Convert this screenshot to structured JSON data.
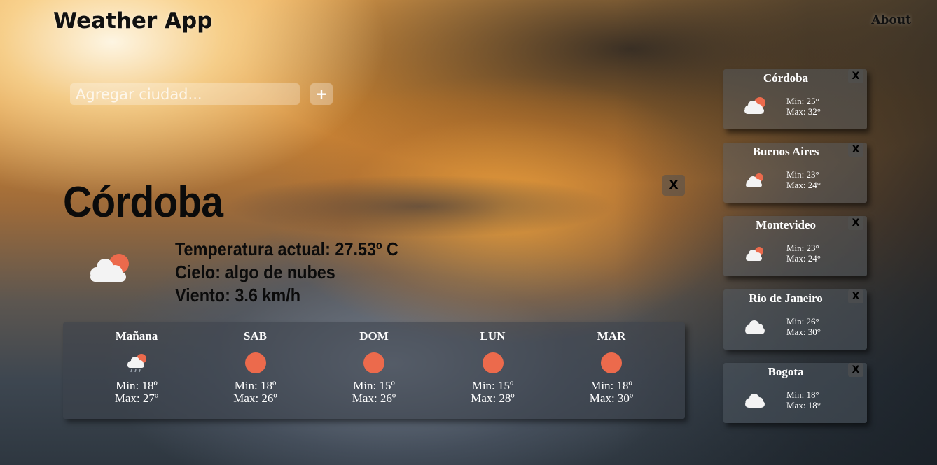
{
  "header": {
    "title": "Weather App",
    "about_label": "About"
  },
  "search": {
    "placeholder": "Agregar ciudad...",
    "add_label": "+"
  },
  "current": {
    "city": "Córdoba",
    "close_label": "X",
    "icon": "cloud-sun-icon",
    "temperature": "Temperatura actual: 27.53º C",
    "sky": "Cielo: algo de nubes",
    "wind": "Viento: 3.6 km/h"
  },
  "forecast": [
    {
      "day": "Mañana",
      "icon": "cloud-rain-sun-icon",
      "min": "Min: 18º",
      "max": "Max: 27º"
    },
    {
      "day": "SAB",
      "icon": "sun-icon",
      "min": "Min: 18º",
      "max": "Max: 26º"
    },
    {
      "day": "DOM",
      "icon": "sun-icon",
      "min": "Min: 15º",
      "max": "Max: 26º"
    },
    {
      "day": "LUN",
      "icon": "sun-icon",
      "min": "Min: 15º",
      "max": "Max: 28º"
    },
    {
      "day": "MAR",
      "icon": "sun-icon",
      "min": "Min: 18º",
      "max": "Max: 30º"
    }
  ],
  "saved_cities": [
    {
      "name": "Córdoba",
      "close_label": "X",
      "icon": "cloud-sun-icon",
      "min": "Min: 25°",
      "max": "Max: 32°"
    },
    {
      "name": "Buenos Aires",
      "close_label": "X",
      "icon": "cloud-sun-icon",
      "min": "Min: 23°",
      "max": "Max: 24°"
    },
    {
      "name": "Montevideo",
      "close_label": "X",
      "icon": "cloud-sun-icon",
      "min": "Min: 23°",
      "max": "Max: 24°"
    },
    {
      "name": "Rio de Janeiro",
      "close_label": "X",
      "icon": "cloud-icon",
      "min": "Min: 26°",
      "max": "Max: 30°"
    },
    {
      "name": "Bogota",
      "close_label": "X",
      "icon": "cloud-icon",
      "min": "Min: 18°",
      "max": "Max: 18°"
    }
  ],
  "colors": {
    "sun": "#ec6a4c",
    "cloud": "#f3f3f3",
    "card_bg": "rgba(90,100,110,0.42)"
  }
}
